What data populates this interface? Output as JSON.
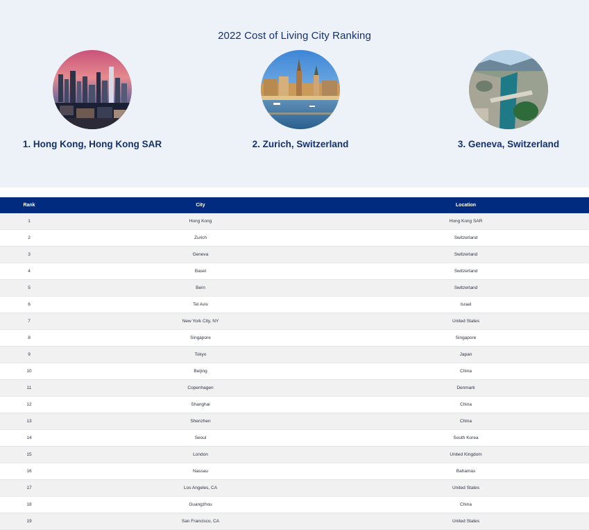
{
  "hero": {
    "title": "2022 Cost of Living City Ranking",
    "featured": [
      {
        "caption": "1. Hong Kong, Hong Kong SAR",
        "image": "hong-kong-skyline-photo"
      },
      {
        "caption": "2. Zurich, Switzerland",
        "image": "zurich-lakefront-photo"
      },
      {
        "caption": "3. Geneva, Switzerland",
        "image": "geneva-river-aerial-photo"
      }
    ]
  },
  "table": {
    "headers": {
      "rank": "Rank",
      "city": "City",
      "location": "Location"
    },
    "rows": [
      {
        "rank": "1",
        "city": "Hong Kong",
        "location": "Hong Kong SAR"
      },
      {
        "rank": "2",
        "city": "Zurich",
        "location": "Switzerland"
      },
      {
        "rank": "3",
        "city": "Geneva",
        "location": "Switzerland"
      },
      {
        "rank": "4",
        "city": "Basel",
        "location": "Switzerland"
      },
      {
        "rank": "5",
        "city": "Bern",
        "location": "Switzerland"
      },
      {
        "rank": "6",
        "city": "Tel Aviv",
        "location": "Israel"
      },
      {
        "rank": "7",
        "city": "New York City, NY",
        "location": "United States"
      },
      {
        "rank": "8",
        "city": "Singapore",
        "location": "Singapore"
      },
      {
        "rank": "9",
        "city": "Tokyo",
        "location": "Japan"
      },
      {
        "rank": "10",
        "city": "Beijing",
        "location": "China"
      },
      {
        "rank": "11",
        "city": "Copenhagen",
        "location": "Denmark"
      },
      {
        "rank": "12",
        "city": "Shanghai",
        "location": "China"
      },
      {
        "rank": "13",
        "city": "Shenzhen",
        "location": "China"
      },
      {
        "rank": "14",
        "city": "Seoul",
        "location": "South Korea"
      },
      {
        "rank": "15",
        "city": "London",
        "location": "United Kingdom"
      },
      {
        "rank": "16",
        "city": "Nassau",
        "location": "Bahamas"
      },
      {
        "rank": "17",
        "city": "Los Angeles, CA",
        "location": "United States"
      },
      {
        "rank": "18",
        "city": "Guangzhou",
        "location": "China"
      },
      {
        "rank": "19",
        "city": "San Francisco, CA",
        "location": "United States"
      }
    ]
  },
  "colors": {
    "hero_background": "#edf2f8",
    "title_text": "#14306e",
    "header_background": "#002b7f",
    "row_alt": "#f1f1f2"
  }
}
